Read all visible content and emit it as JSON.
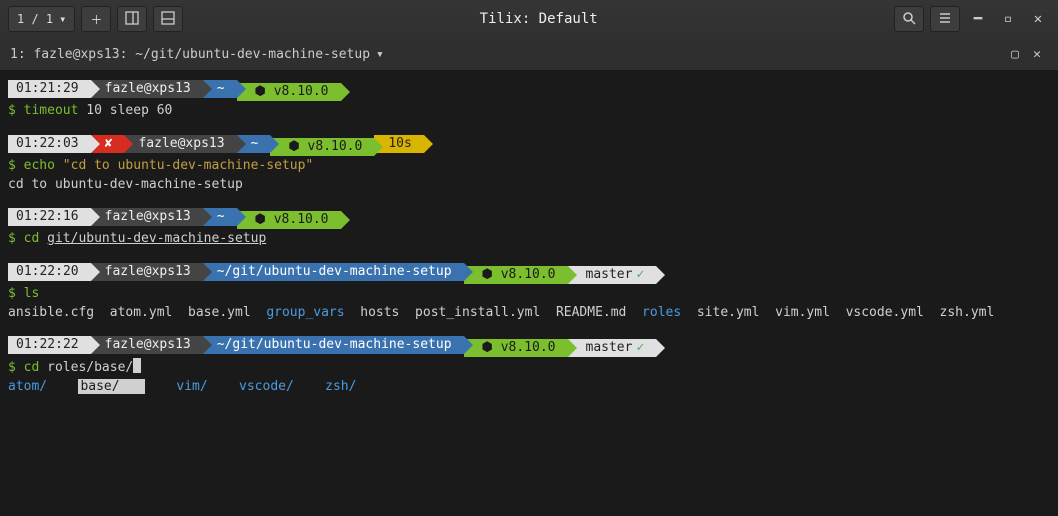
{
  "titlebar": {
    "sessions": "1 / 1",
    "title": "Tilix: Default"
  },
  "tab": {
    "label": "1: fazle@xps13: ~/git/ubuntu-dev-machine-setup"
  },
  "prompts": [
    {
      "time": "01:21:29",
      "fail": false,
      "user": "fazle@xps13",
      "path": "~",
      "node": "⬢ v8.10.0",
      "duration": null,
      "git": null,
      "command_prefix": "$ ",
      "command_name": "timeout",
      "command_rest": " 10 sleep 60",
      "output": null
    },
    {
      "time": "01:22:03",
      "fail": true,
      "fail_mark": "✘",
      "user": "fazle@xps13",
      "path": "~",
      "node": "⬢ v8.10.0",
      "duration": "10s",
      "git": null,
      "command_prefix": "$ ",
      "command_name": "echo",
      "command_string": "\"cd to ubuntu-dev-machine-setup\"",
      "output": "cd to ubuntu-dev-machine-setup"
    },
    {
      "time": "01:22:16",
      "fail": false,
      "user": "fazle@xps13",
      "path": "~",
      "node": "⬢ v8.10.0",
      "duration": null,
      "git": null,
      "command_prefix": "$ ",
      "command_name": "cd",
      "command_underline": "git/ubuntu-dev-machine-setup",
      "output": null
    },
    {
      "time": "01:22:20",
      "fail": false,
      "user": "fazle@xps13",
      "path": "~/git/ubuntu-dev-machine-setup",
      "node": "⬢ v8.10.0",
      "duration": null,
      "git": "master",
      "git_clean": "✓",
      "command_prefix": "$ ",
      "command_name": "ls",
      "ls_output": [
        "ansible.cfg",
        "atom.yml",
        "base.yml",
        "group_vars",
        "hosts",
        "post_install.yml",
        "README.md",
        "roles",
        "site.yml",
        "vim.yml",
        "vscode.yml",
        "zsh.yml"
      ],
      "ls_dirs": [
        "group_vars",
        "roles"
      ]
    },
    {
      "time": "01:22:22",
      "fail": false,
      "user": "fazle@xps13",
      "path": "~/git/ubuntu-dev-machine-setup",
      "node": "⬢ v8.10.0",
      "duration": null,
      "git": "master",
      "git_clean": "✓",
      "command_prefix": "$ ",
      "command_name": "cd",
      "command_rest": " roles/base/",
      "completions": [
        "atom/",
        "base/",
        "vim/",
        "vscode/",
        "zsh/"
      ],
      "completion_selected": "base/"
    }
  ]
}
